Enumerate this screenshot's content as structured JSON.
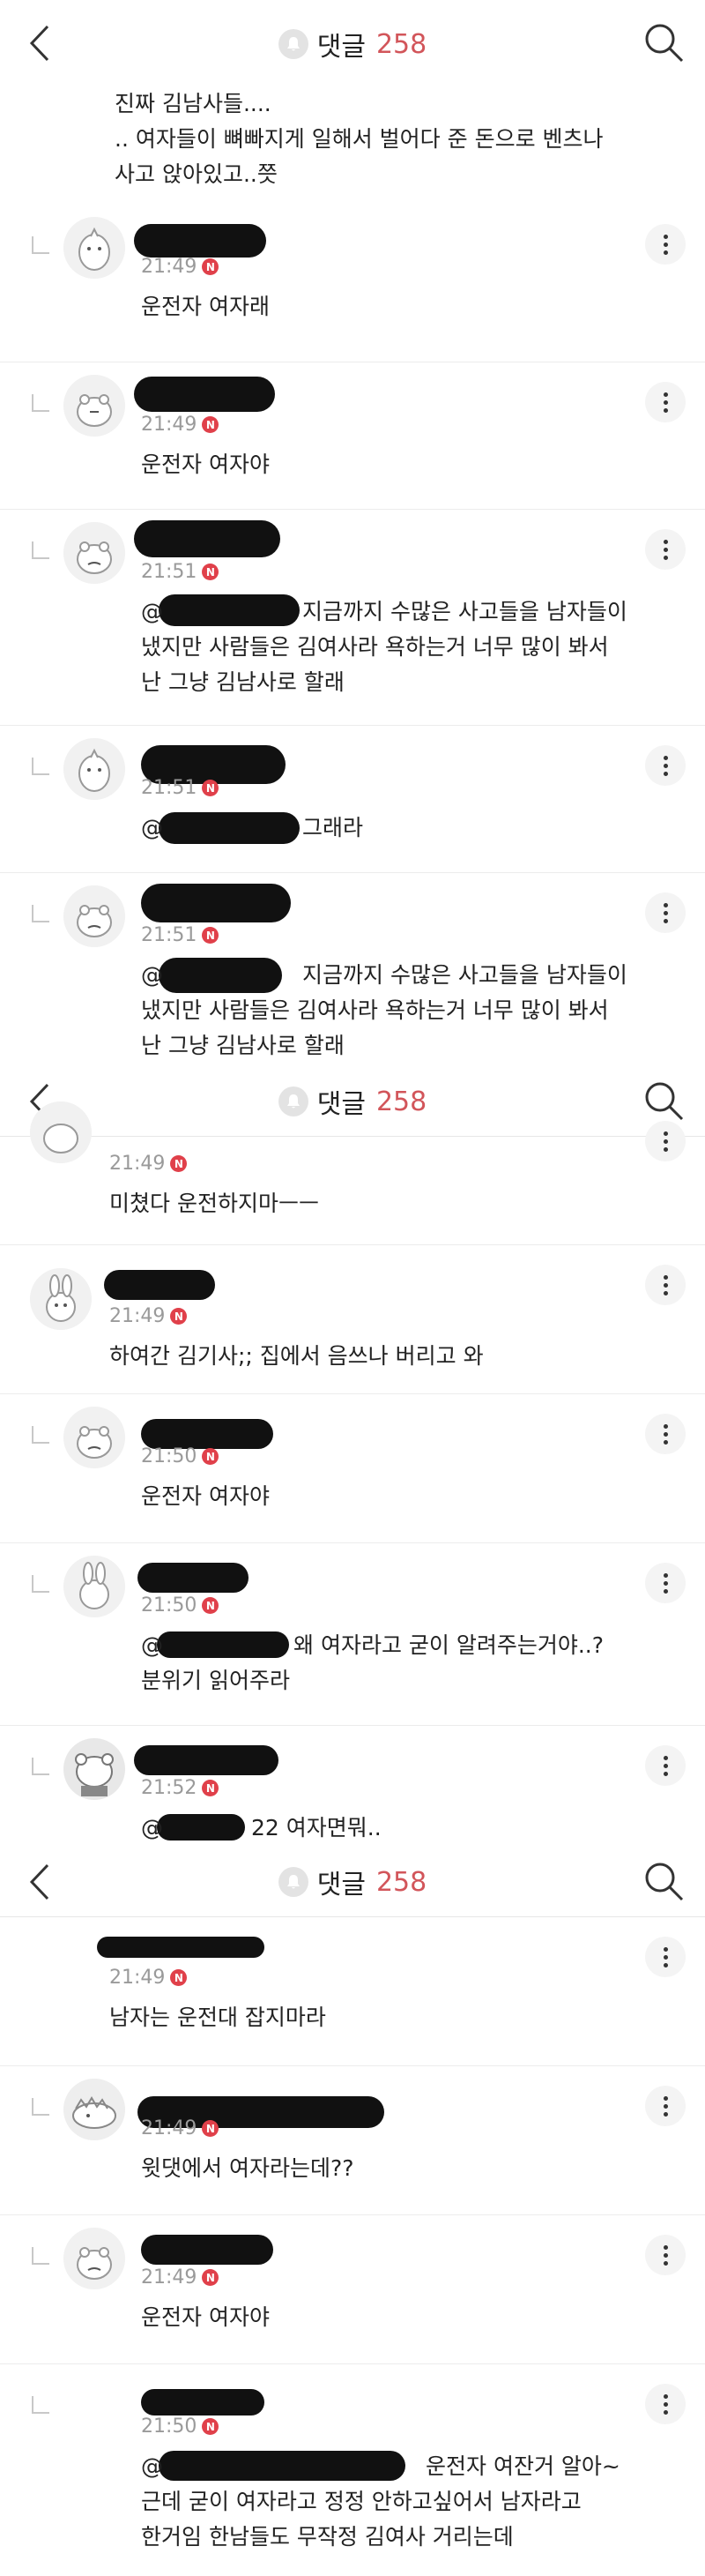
{
  "header": {
    "title": "댓글",
    "count": "258"
  },
  "section1": {
    "top_comment": {
      "text": "진짜 김남사들....\n.. 여자들이 뼈빠지게 일해서 벌어다 준 돈으로 벤츠나\n사고 앉아있고..쯧"
    },
    "replies": [
      {
        "time": "21:49",
        "text": "운전자 여자래"
      },
      {
        "time": "21:49",
        "text": "운전자 여자야"
      },
      {
        "time": "21:51",
        "mention": "@",
        "text": "지금까지 수많은 사고들을 남자들이\n냈지만 사람들은 김여사라 욕하는거 너무 많이 봐서\n난 그냥 김남사로 할래"
      },
      {
        "time": "21:51",
        "mention": "@",
        "text": "그래라"
      },
      {
        "time": "21:51",
        "mention": "@",
        "text": "지금까지 수많은 사고들을 남자들이\n냈지만 사람들은 김여사라 욕하는거 너무 많이 봐서\n난 그냥 김남사로 할래"
      }
    ]
  },
  "section2": {
    "replies": [
      {
        "time": "21:49",
        "text": "미쳤다 운전하지마ㅡㅡ"
      },
      {
        "time": "21:49",
        "text": "하여간 김기사;; 집에서 음쓰나 버리고 와"
      },
      {
        "time": "21:50",
        "text": "운전자 여자야"
      },
      {
        "time": "21:50",
        "mention": "@",
        "text": "왜 여자라고 굳이 알려주는거야..?\n분위기 읽어주라"
      },
      {
        "time": "21:52",
        "mention": "@",
        "text": "22 여자면뭐.."
      }
    ]
  },
  "section3": {
    "replies": [
      {
        "time": "21:49",
        "text": "남자는 운전대 잡지마라"
      },
      {
        "time": "21:49",
        "text": "윗댓에서 여자라는데??"
      },
      {
        "time": "21:49",
        "text": "운전자 여자야"
      },
      {
        "time": "21:50",
        "mention": "@",
        "text": "운전자 여잔거 알아~\n근데 굳이 여자라고 정정 안하고싶어서 남자라고\n한거임 한남들도 무작정 김여사 거리는데"
      }
    ]
  },
  "icons": {
    "back": "chevron-left-icon",
    "search": "search-icon",
    "bell": "bell-icon",
    "more": "more-vertical-icon",
    "badge": "n-badge-icon"
  },
  "colors": {
    "accent": "#d2555a",
    "badge": "#e0404a"
  }
}
